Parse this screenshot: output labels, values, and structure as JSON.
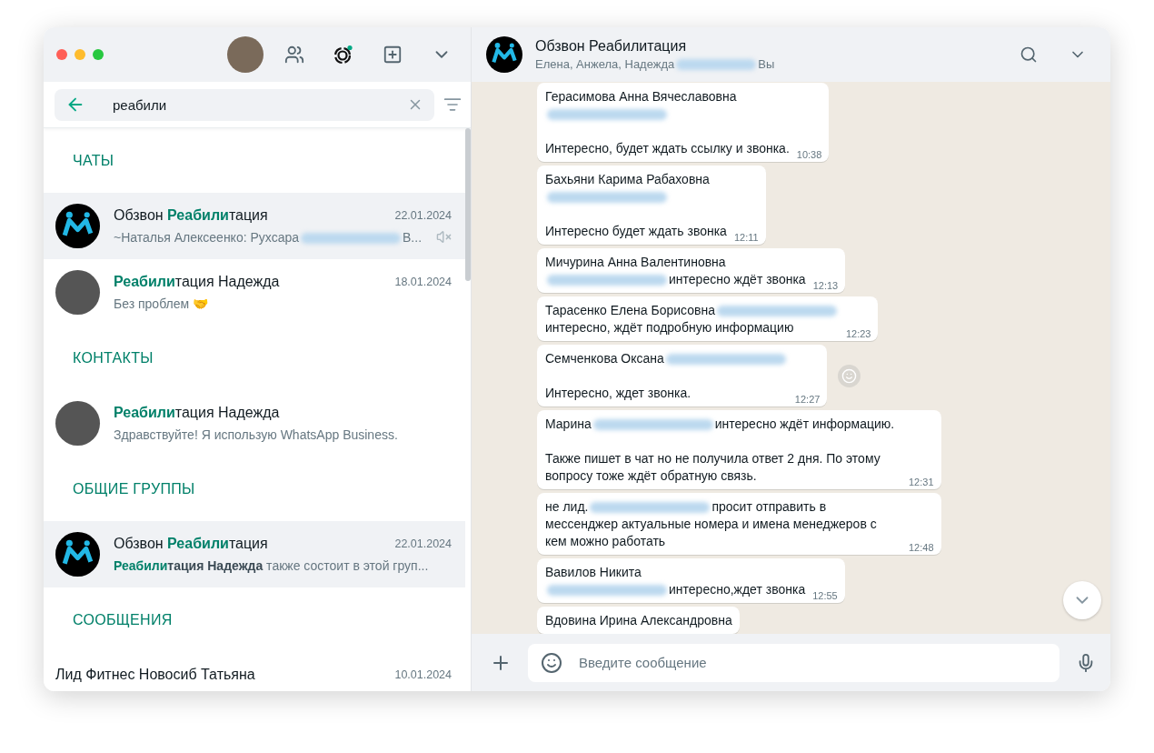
{
  "sidebar": {
    "search": {
      "value": "реабили"
    },
    "sections": [
      {
        "title": "ЧАТЫ",
        "items": [
          {
            "kind": "logo",
            "title": "Обзвон **Реабили**тация",
            "date": "22.01.2024",
            "preview": [
              {
                "kind": "text",
                "text": "~Наталья Алексеенко: Рухсара"
              },
              {
                "kind": "redacted"
              },
              {
                "kind": "text",
                "text": "В..."
              }
            ],
            "muted": true,
            "selected": true
          },
          {
            "kind": "photo",
            "title": "**Реабили**тация Надежда",
            "date": "18.01.2024",
            "preview": [
              {
                "kind": "text",
                "text": "Без проблем 🤝"
              }
            ],
            "muted": false,
            "selected": false
          }
        ]
      },
      {
        "title": "КОНТАКТЫ",
        "items": [
          {
            "kind": "photo",
            "title": "**Реабили**тация Надежда",
            "preview": [
              {
                "kind": "text",
                "text": "Здравствуйте! Я использую WhatsApp Business."
              }
            ],
            "muted": false,
            "selected": false
          }
        ]
      },
      {
        "title": "ОБЩИЕ ГРУППЫ",
        "items": [
          {
            "kind": "logo",
            "title": "Обзвон **Реабили**тация",
            "date": "22.01.2024",
            "preview": [
              {
                "kind": "text",
                "text": "**Реабили**"
              },
              {
                "kind": "text",
                "text": "*тация Надежда* также состоит в этой груп..."
              }
            ],
            "muted": false,
            "selected": true
          }
        ]
      },
      {
        "title": "СООБЩЕНИЯ",
        "items": [
          {
            "kind": "plain",
            "title": "Лид Фитнес Новосиб Татьяна",
            "date": "10.01.2024",
            "muted": false,
            "selected": false
          }
        ]
      }
    ]
  },
  "chat": {
    "title": "Обзвон Реабилитация",
    "subtitle": [
      {
        "kind": "text",
        "text": "Елена, Анжела, Надежда"
      },
      {
        "kind": "redacted"
      },
      {
        "kind": "text",
        "text": "Вы"
      }
    ],
    "messages": [
      {
        "lines": [
          {
            "kind": "text",
            "parts": [
              {
                "kind": "text",
                "text": "Герасимова Анна Вячеславовна"
              }
            ]
          },
          {
            "kind": "text",
            "parts": [
              {
                "kind": "redacted"
              }
            ]
          },
          {
            "kind": "blank"
          },
          {
            "kind": "text",
            "parts": [
              {
                "kind": "text",
                "text": "Интересно, будет ждать ссылку и звонка."
              }
            ]
          }
        ],
        "time": "10:38",
        "react": false
      },
      {
        "lines": [
          {
            "kind": "text",
            "parts": [
              {
                "kind": "text",
                "text": "Бахьяни Карима Рабаховна"
              }
            ]
          },
          {
            "kind": "text",
            "parts": [
              {
                "kind": "redacted"
              }
            ]
          },
          {
            "kind": "blank"
          },
          {
            "kind": "text",
            "parts": [
              {
                "kind": "text",
                "text": "Интересно будет ждать звонка"
              }
            ]
          }
        ],
        "time": "12:11",
        "react": false
      },
      {
        "lines": [
          {
            "kind": "text",
            "parts": [
              {
                "kind": "text",
                "text": "Мичурина Анна Валентиновна"
              }
            ]
          },
          {
            "kind": "text",
            "parts": [
              {
                "kind": "redacted"
              },
              {
                "kind": "text",
                "text": "интересно ждёт звонка"
              }
            ]
          }
        ],
        "time": "12:13",
        "react": false
      },
      {
        "lines": [
          {
            "kind": "text",
            "parts": [
              {
                "kind": "text",
                "text": "Тарасенко Елена Борисовна"
              },
              {
                "kind": "redacted"
              }
            ]
          },
          {
            "kind": "text",
            "parts": [
              {
                "kind": "text",
                "text": "интересно, ждёт подробную информацию"
              }
            ]
          }
        ],
        "time": "12:23",
        "react": false
      },
      {
        "lines": [
          {
            "kind": "text",
            "parts": [
              {
                "kind": "text",
                "text": "Семченкова Оксана"
              },
              {
                "kind": "redacted"
              }
            ]
          },
          {
            "kind": "blank"
          },
          {
            "kind": "text",
            "parts": [
              {
                "kind": "text",
                "text": "Интересно, ждет звонка."
              }
            ]
          }
        ],
        "time": "12:27",
        "react": true
      },
      {
        "lines": [
          {
            "kind": "text",
            "parts": [
              {
                "kind": "text",
                "text": "Марина"
              },
              {
                "kind": "redacted"
              },
              {
                "kind": "text",
                "text": "интересно ждёт информацию."
              }
            ]
          },
          {
            "kind": "blank"
          },
          {
            "kind": "text",
            "parts": [
              {
                "kind": "text",
                "text": "Также пишет в чат но не получила ответ 2 дня. По этому вопросу тоже ждёт обратную связь."
              }
            ]
          }
        ],
        "time": "12:31",
        "react": false
      },
      {
        "lines": [
          {
            "kind": "text",
            "parts": [
              {
                "kind": "text",
                "text": "не  лид."
              },
              {
                "kind": "redacted"
              },
              {
                "kind": "text",
                "text": "просит отправить в мессенджер актуальные номера и имена менеджеров с кем можно работать"
              }
            ]
          }
        ],
        "time": "12:48",
        "react": false
      },
      {
        "lines": [
          {
            "kind": "text",
            "parts": [
              {
                "kind": "text",
                "text": "Вавилов Никита"
              }
            ]
          },
          {
            "kind": "text",
            "parts": [
              {
                "kind": "redacted"
              },
              {
                "kind": "text",
                "text": "интересно,ждет звонка"
              }
            ]
          }
        ],
        "time": "12:55",
        "react": false
      },
      {
        "lines": [
          {
            "kind": "text",
            "parts": [
              {
                "kind": "text",
                "text": "Вдовина Ирина Александровна"
              }
            ]
          }
        ],
        "react": false
      }
    ],
    "composer": {
      "placeholder": "Введите сообщение"
    }
  }
}
